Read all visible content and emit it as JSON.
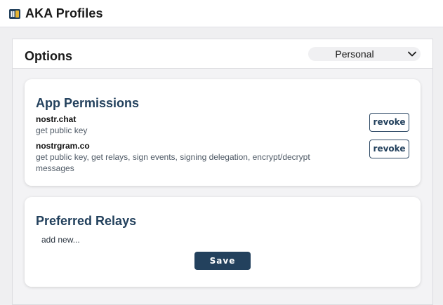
{
  "app": {
    "title": "AKA Profiles",
    "logo_icon": "aka-logo-icon"
  },
  "options": {
    "title": "Options",
    "profile_select": {
      "selected": "Personal",
      "icon": "chevron-down-icon"
    }
  },
  "permissions": {
    "title": "App Permissions",
    "items": [
      {
        "host": "nostr.chat",
        "scopes": "get public key",
        "action_label": "revoke"
      },
      {
        "host": "nostrgram.co",
        "scopes": "get public key, get relays, sign events, signing delegation, encrypt/decrypt messages",
        "action_label": "revoke"
      }
    ]
  },
  "relays": {
    "title": "Preferred Relays",
    "add_new_placeholder": "add new...",
    "save_label": "Save"
  },
  "colors": {
    "accent": "#23415d",
    "page_background": "#efeff1",
    "card_background": "#ffffff"
  }
}
